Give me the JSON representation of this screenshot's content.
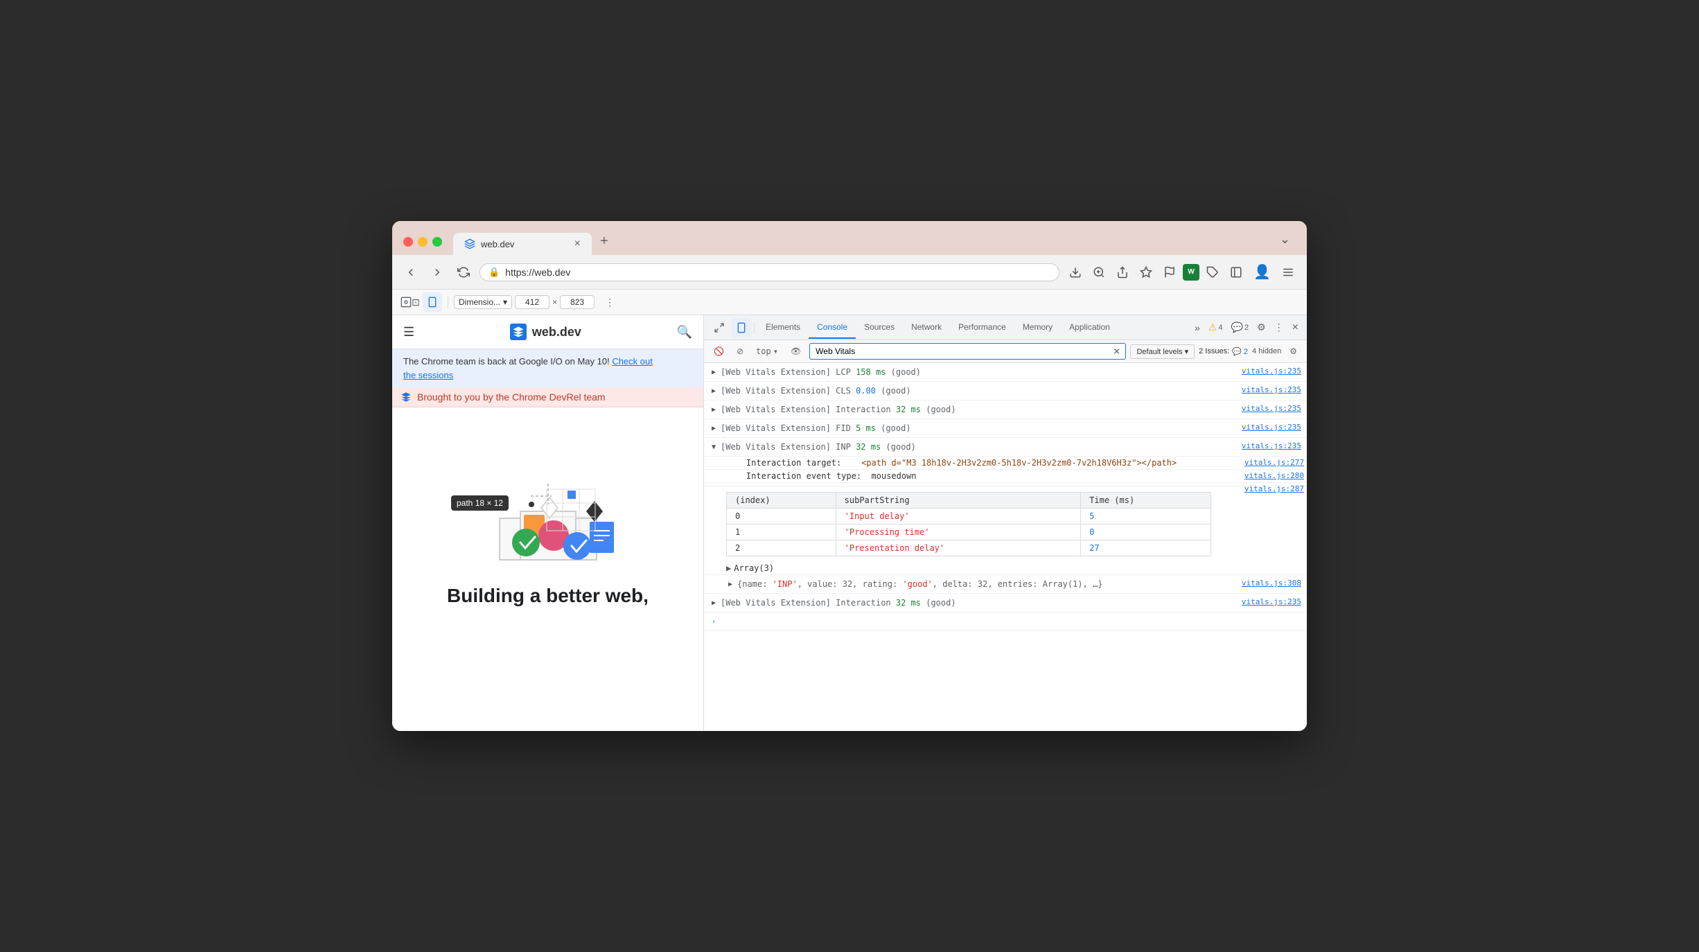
{
  "browser": {
    "tab_title": "web.dev",
    "tab_close": "×",
    "new_tab": "+",
    "more_label": "⌄",
    "url": "https://web.dev",
    "back_title": "Back",
    "forward_title": "Forward",
    "reload_title": "Reload"
  },
  "devtools_bar": {
    "dimension_label": "Dimensio...",
    "width": "412",
    "height": "823",
    "x_sep": "×",
    "more": "⋮"
  },
  "devtools": {
    "tabs": [
      "Elements",
      "Console",
      "Sources",
      "Network",
      "Performance",
      "Memory",
      "Application"
    ],
    "active_tab": "Console",
    "icons": {
      "inspect": "⊡",
      "device": "☐",
      "more": "»"
    },
    "badge_warning": "⚠ 4",
    "badge_chat": "💬 2",
    "settings": "⚙",
    "more_options": "⋮",
    "close": "×"
  },
  "console": {
    "toolbar": {
      "clear": "🚫",
      "top_label": "top",
      "top_arrow": "▾",
      "eye_label": "👁",
      "search_placeholder": "Web Vitals",
      "search_value": "Web Vitals",
      "clear_icon": "×",
      "default_levels": "Default levels",
      "default_levels_arrow": "▾",
      "issues_label": "2 Issues:",
      "issues_badge": "💬 2",
      "hidden_label": "4 hidden",
      "settings_icon": "⚙"
    },
    "entries": [
      {
        "id": "lcp",
        "expanded": false,
        "toggle": "▶",
        "text": "[Web Vitals Extension] LCP ",
        "value": "158 ms",
        "value_color": "green",
        "suffix": " (good)",
        "source": "vitals.js:235"
      },
      {
        "id": "cls",
        "expanded": false,
        "toggle": "▶",
        "text": "[Web Vitals Extension] CLS ",
        "value": "0.00",
        "value_color": "blue",
        "suffix": " (good)",
        "source": "vitals.js:235"
      },
      {
        "id": "interaction",
        "expanded": false,
        "toggle": "▶",
        "text": "[Web Vitals Extension] Interaction ",
        "value": "32 ms",
        "value_color": "green",
        "suffix": " (good)",
        "source": "vitals.js:235"
      },
      {
        "id": "fid",
        "expanded": false,
        "toggle": "▶",
        "text": "[Web Vitals Extension] FID ",
        "value": "5 ms",
        "value_color": "green",
        "suffix": " (good)",
        "source": "vitals.js:235"
      },
      {
        "id": "inp",
        "expanded": true,
        "toggle": "▼",
        "text": "[Web Vitals Extension] INP ",
        "value": "32 ms",
        "value_color": "green",
        "suffix": " (good)",
        "source": "vitals.js:235"
      }
    ],
    "inp_details": {
      "target_label": "Interaction target:",
      "target_value": "<path d=\"M3 18h18v-2H3v2zm0-5h18v-2H3v2zm0-7v2h18V6H3z\"></path>",
      "target_source": "vitals.js:277",
      "event_type_label": "Interaction event type:",
      "event_type_value": "mousedown",
      "event_type_source": "vitals.js:280",
      "extra_source": "vitals.js:287"
    },
    "table": {
      "headers": [
        "(index)",
        "subPartString",
        "Time (ms)"
      ],
      "rows": [
        {
          "index": "0",
          "sub": "'Input delay'",
          "sub_color": "red",
          "time": "5",
          "time_color": "blue"
        },
        {
          "index": "1",
          "sub": "'Processing time'",
          "sub_color": "red",
          "time": "0",
          "time_color": "blue"
        },
        {
          "index": "2",
          "sub": "'Presentation delay'",
          "sub_color": "red",
          "time": "27",
          "time_color": "blue"
        }
      ],
      "array_label": "▶Array(3)",
      "object_label": "▶{name: 'INP', value: 32, rating: 'good', delta: 32, entries: Array(1), …}",
      "object_source": "vitals.js:308"
    },
    "last_entry": {
      "toggle": "▶",
      "text": "[Web Vitals Extension] Interaction ",
      "value": "32 ms",
      "value_color": "green",
      "suffix": " (good)",
      "source": "vitals.js:235"
    },
    "prompt_icon": ">"
  },
  "page": {
    "logo_text": "web.dev",
    "announcement": "The Chrome team is back at Google I/O on May 10! Check out the sessions",
    "announcement_link": "Check out the sessions",
    "promo_text": "Brought to you by the Chrome DevRel team",
    "hero_title": "Building a better web,",
    "tooltip_text": "path  18 × 12"
  }
}
